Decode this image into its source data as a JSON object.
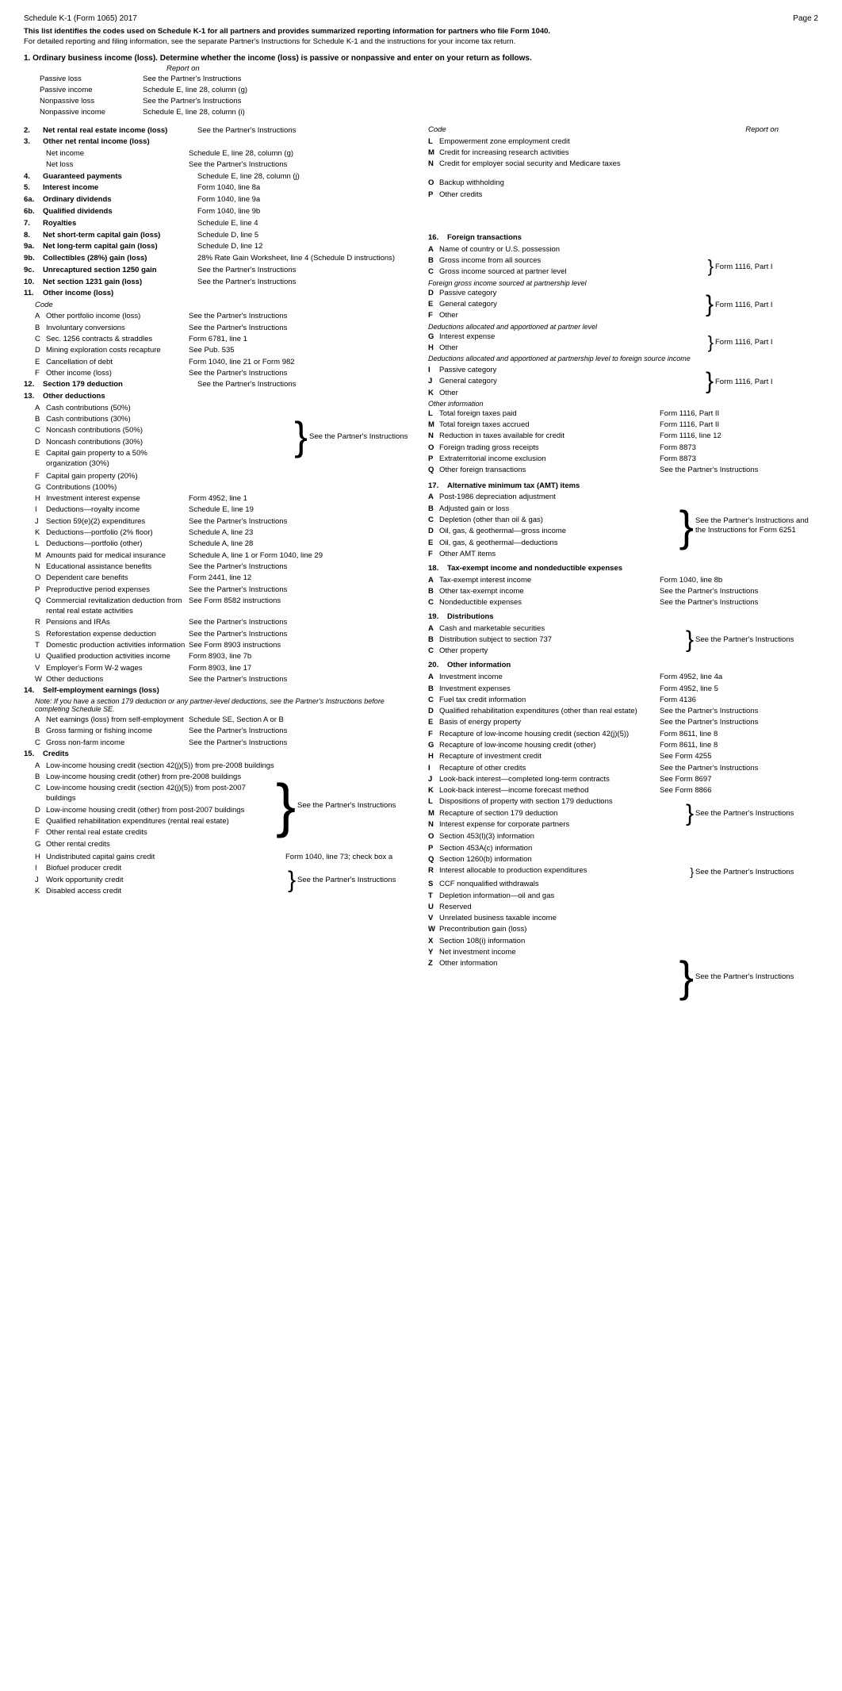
{
  "header": {
    "left": "Schedule K-1 (Form 1065) 2017",
    "right": "Page 2"
  },
  "intro": {
    "line1": "This list identifies the codes used on Schedule K-1 for all partners and provides summarized reporting information for partners who file Form 1040.",
    "line2": "For detailed reporting and filing information, see the separate Partner's Instructions for Schedule K-1 and the instructions for your income tax return."
  },
  "section1": {
    "title": "1. Ordinary business income (loss).",
    "desc": "Determine whether the income (loss) is passive or nonpassive and enter on your return as follows.",
    "report_on_label": "Report on",
    "items": [
      {
        "label": "Passive loss",
        "value": "See the Partner's Instructions"
      },
      {
        "label": "Passive income",
        "value": "Schedule E, line 28, column (g)"
      },
      {
        "label": "Nonpassive loss",
        "value": "See the Partner's Instructions"
      },
      {
        "label": "Nonpassive income",
        "value": "Schedule E, line 28, column (i)"
      }
    ]
  },
  "left_items": [
    {
      "num": "2.",
      "label": "Net rental real estate income (loss)",
      "bold": true,
      "instruction": "See the Partner's Instructions"
    },
    {
      "num": "3.",
      "label": "Other net rental income (loss)",
      "bold": true,
      "instruction": ""
    },
    {
      "sub": [
        {
          "label": "Net income",
          "instruction": "Schedule E, line 28, column (g)"
        },
        {
          "label": "Net loss",
          "instruction": "See the Partner's Instructions"
        }
      ]
    },
    {
      "num": "4.",
      "label": "Guaranteed payments",
      "bold": true,
      "instruction": "Schedule E, line 28, column (j)"
    },
    {
      "num": "5.",
      "label": "Interest income",
      "bold": true,
      "instruction": "Form 1040, line 8a"
    },
    {
      "num": "6a.",
      "label": "Ordinary dividends",
      "bold": true,
      "instruction": "Form 1040, line 9a"
    },
    {
      "num": "6b.",
      "label": "Qualified dividends",
      "bold": true,
      "instruction": "Form 1040, line 9b"
    },
    {
      "num": "7.",
      "label": "Royalties",
      "bold": true,
      "instruction": "Schedule E, line 4"
    },
    {
      "num": "8.",
      "label": "Net short-term capital gain (loss)",
      "bold": true,
      "instruction": "Schedule D, line 5"
    },
    {
      "num": "9a.",
      "label": "Net long-term capital gain (loss)",
      "bold": true,
      "instruction": "Schedule D, line 12"
    },
    {
      "num": "9b.",
      "label": "Collectibles (28%) gain (loss)",
      "bold": true,
      "instruction": "28% Rate Gain Worksheet, line 4 (Schedule D instructions)"
    },
    {
      "num": "9c.",
      "label": "Unrecaptured section 1250 gain",
      "bold": true,
      "instruction": "See the Partner's Instructions"
    },
    {
      "num": "10.",
      "label": "Net section 1231 gain (loss)",
      "bold": true,
      "instruction": "See the Partner's Instructions"
    },
    {
      "num": "11.",
      "label": "Other income (loss)",
      "bold": true,
      "instruction": ""
    },
    {
      "code_label": "Code",
      "sub_codes": [
        {
          "code": "A",
          "label": "Other portfolio income (loss)",
          "instruction": "See the Partner's Instructions"
        },
        {
          "code": "B",
          "label": "Involuntary conversions",
          "instruction": "See the Partner's Instructions"
        },
        {
          "code": "C",
          "label": "Sec. 1256 contracts & straddles",
          "instruction": "Form 6781, line 1"
        },
        {
          "code": "D",
          "label": "Mining exploration costs recapture",
          "instruction": "See Pub. 535"
        },
        {
          "code": "E",
          "label": "Cancellation of debt",
          "instruction": "Form 1040, line 21 or Form 982"
        },
        {
          "code": "F",
          "label": "Other income (loss)",
          "instruction": "See the Partner's Instructions"
        }
      ]
    },
    {
      "num": "12.",
      "label": "Section 179 deduction",
      "bold": true,
      "instruction": "See the Partner's Instructions"
    },
    {
      "num": "13.",
      "label": "Other deductions",
      "bold": true,
      "instruction": ""
    },
    {
      "sub_codes_deductions": [
        {
          "code": "A",
          "label": "Cash contributions (50%)"
        },
        {
          "code": "B",
          "label": "Cash contributions (30%)"
        },
        {
          "code": "C",
          "label": "Noncash contributions (50%)"
        },
        {
          "code": "D",
          "label": "Noncash contributions (30%)"
        },
        {
          "code": "E",
          "label": "Capital gain property to a 50% organization (30%)"
        }
      ],
      "brace_instruction": "See the Partner's Instructions"
    },
    {
      "sub_codes_deductions2": [
        {
          "code": "F",
          "label": "Capital gain property (20%)"
        },
        {
          "code": "G",
          "label": "Contributions (100%)"
        }
      ]
    },
    {
      "sub_codes_deductions3": [
        {
          "code": "H",
          "label": "Investment interest expense",
          "instruction": "Form 4952, line 1"
        },
        {
          "code": "I",
          "label": "Deductions—royalty income",
          "instruction": "Schedule E, line 19"
        },
        {
          "code": "J",
          "label": "Section 59(e)(2) expenditures",
          "instruction": "See the Partner's Instructions"
        },
        {
          "code": "K",
          "label": "Deductions—portfolio (2% floor)",
          "instruction": "Schedule A, line 23"
        },
        {
          "code": "L",
          "label": "Deductions—portfolio (other)",
          "instruction": "Schedule A, line 28"
        },
        {
          "code": "M",
          "label": "Amounts paid for medical insurance",
          "instruction": "Schedule A, line 1 or Form 1040, line 29"
        },
        {
          "code": "N",
          "label": "Educational assistance benefits",
          "instruction": "See the Partner's Instructions"
        },
        {
          "code": "O",
          "label": "Dependent care benefits",
          "instruction": "Form 2441, line 12"
        },
        {
          "code": "P",
          "label": "Preproductive period expenses",
          "instruction": "See the Partner's Instructions"
        },
        {
          "code": "Q",
          "label": "Commercial revitalization deduction from rental real estate activities",
          "instruction": "See Form 8582 instructions"
        },
        {
          "code": "R",
          "label": "Pensions and IRAs",
          "instruction": "See the Partner's Instructions"
        },
        {
          "code": "S",
          "label": "Reforestation expense deduction",
          "instruction": "See the Partner's Instructions"
        },
        {
          "code": "T",
          "label": "Domestic production activities information",
          "instruction": "See Form 8903 instructions"
        },
        {
          "code": "U",
          "label": "Qualified production activities income",
          "instruction": "Form 8903, line 7b"
        },
        {
          "code": "V",
          "label": "Employer's Form W-2 wages",
          "instruction": "Form 8903, line 17"
        },
        {
          "code": "W",
          "label": "Other deductions",
          "instruction": "See the Partner's Instructions"
        }
      ]
    },
    {
      "num": "14.",
      "label": "Self-employment earnings (loss)",
      "bold": true,
      "instruction": ""
    },
    {
      "note": "Note: If you have a section 179 deduction or any partner-level deductions, see the Partner's Instructions before completing Schedule SE."
    },
    {
      "sub_codes_se": [
        {
          "code": "A",
          "label": "Net earnings (loss) from self-employment",
          "instruction": "Schedule SE, Section A or B"
        },
        {
          "code": "B",
          "label": "Gross farming or fishing income",
          "instruction": "See the Partner's Instructions"
        },
        {
          "code": "C",
          "label": "Gross non-farm income",
          "instruction": "See the Partner's Instructions"
        }
      ]
    },
    {
      "num": "15.",
      "label": "Credits",
      "bold": true,
      "instruction": ""
    }
  ],
  "credits_items": [
    {
      "code": "A",
      "label": "Low-income housing credit (section 42(j)(5)) from pre-2008 buildings"
    },
    {
      "code": "B",
      "label": "Low-income housing credit (other) from pre-2008 buildings"
    },
    {
      "code": "C",
      "label": "Low-income housing credit (section 42(j)(5)) from post-2007 buildings"
    },
    {
      "code": "D",
      "label": "Low-income housing credit (other) from post-2007 buildings"
    },
    {
      "code": "E",
      "label": "Qualified rehabilitation expenditures (rental real estate)"
    },
    {
      "code": "F",
      "label": "Other rental real estate credits"
    },
    {
      "code": "G",
      "label": "Other rental credits"
    },
    {
      "code": "H",
      "label": "Undistributed capital gains credit",
      "instruction": "Form 1040, line 73; check box a"
    },
    {
      "code": "I",
      "label": "Biofuel producer credit"
    },
    {
      "code": "J",
      "label": "Work opportunity credit"
    },
    {
      "code": "K",
      "label": "Disabled access credit"
    }
  ],
  "credits_brace_instruction": "See the Partner's Instructions",
  "right_items": {
    "code_header": "Code",
    "report_on_header": "Report on",
    "items": [
      {
        "code": "L",
        "label": "Empowerment zone employment credit"
      },
      {
        "code": "M",
        "label": "Credit for increasing research activities"
      },
      {
        "code": "N",
        "label": "Credit for employer social security and Medicare taxes"
      }
    ],
    "op_items": [
      {
        "code": "O",
        "label": "Backup withholding"
      },
      {
        "code": "P",
        "label": "Other credits"
      }
    ],
    "section16": {
      "num": "16.",
      "title": "Foreign transactions",
      "items": [
        {
          "code": "A",
          "label": "Name of country or U.S. possession"
        },
        {
          "code": "B",
          "label": "Gross income from all sources"
        },
        {
          "code": "C",
          "label": "Gross income sourced at partner level"
        }
      ],
      "brace_instruction_bc": "Form 1116, Part I",
      "foreign_gross_label": "Foreign gross income sourced at partnership level",
      "items2": [
        {
          "code": "D",
          "label": "Passive category"
        },
        {
          "code": "E",
          "label": "General category"
        },
        {
          "code": "F",
          "label": "Other"
        }
      ],
      "brace_instruction_def": "Form 1116, Part I",
      "deductions_label1": "Deductions allocated and apportioned at partner level",
      "items3": [
        {
          "code": "G",
          "label": "Interest expense"
        },
        {
          "code": "H",
          "label": "Other"
        }
      ],
      "brace_instruction_gh": "Form 1116, Part I",
      "deductions_label2": "Deductions allocated and apportioned at partnership level to foreign source income",
      "items4": [
        {
          "code": "I",
          "label": "Passive category"
        },
        {
          "code": "J",
          "label": "General category"
        },
        {
          "code": "K",
          "label": "Other"
        }
      ],
      "brace_instruction_ijk": "Form 1116, Part I",
      "other_info_label": "Other information",
      "items5": [
        {
          "code": "L",
          "label": "Total foreign taxes paid",
          "instruction": "Form 1116, Part II"
        },
        {
          "code": "M",
          "label": "Total foreign taxes accrued",
          "instruction": "Form 1116, Part II"
        },
        {
          "code": "N",
          "label": "Reduction in taxes available for credit",
          "instruction": "Form 1116, line 12"
        },
        {
          "code": "O",
          "label": "Foreign trading gross receipts",
          "instruction": "Form 8873"
        },
        {
          "code": "P",
          "label": "Extraterritorial income exclusion",
          "instruction": "Form 8873"
        },
        {
          "code": "Q",
          "label": "Other foreign transactions",
          "instruction": "See the Partner's Instructions"
        }
      ]
    },
    "section17": {
      "num": "17.",
      "title": "Alternative minimum tax (AMT) items",
      "items": [
        {
          "code": "A",
          "label": "Post-1986 depreciation adjustment"
        },
        {
          "code": "B",
          "label": "Adjusted gain or loss"
        },
        {
          "code": "C",
          "label": "Depletion (other than oil & gas)"
        },
        {
          "code": "D",
          "label": "Oil, gas, & geothermal—gross income"
        },
        {
          "code": "E",
          "label": "Oil, gas, & geothermal—deductions"
        },
        {
          "code": "F",
          "label": "Other AMT items"
        }
      ],
      "brace_instruction": "See the Partner's Instructions and the Instructions for Form 6251"
    },
    "section18": {
      "num": "18.",
      "title": "Tax-exempt income and nondeductible expenses",
      "items": [
        {
          "code": "A",
          "label": "Tax-exempt interest income",
          "instruction": "Form 1040, line 8b"
        },
        {
          "code": "B",
          "label": "Other tax-exempt income",
          "instruction": "See the Partner's Instructions"
        },
        {
          "code": "C",
          "label": "Nondeductible expenses",
          "instruction": "See the Partner's Instructions"
        }
      ]
    },
    "section19": {
      "num": "19.",
      "title": "Distributions",
      "items": [
        {
          "code": "A",
          "label": "Cash and marketable securities"
        },
        {
          "code": "B",
          "label": "Distribution subject to section 737"
        },
        {
          "code": "C",
          "label": "Other property"
        }
      ],
      "brace_instruction": "See the Partner's Instructions"
    },
    "section20": {
      "num": "20.",
      "title": "Other information",
      "items": [
        {
          "code": "A",
          "label": "Investment income",
          "instruction": "Form 4952, line 4a"
        },
        {
          "code": "B",
          "label": "Investment expenses",
          "instruction": "Form 4952, line 5"
        },
        {
          "code": "C",
          "label": "Fuel tax credit information",
          "instruction": "Form 4136"
        },
        {
          "code": "D",
          "label": "Qualified rehabilitation expenditures (other than real estate)",
          "instruction": "See the Partner's Instructions"
        },
        {
          "code": "E",
          "label": "Basis of energy property",
          "instruction": "See the Partner's Instructions"
        },
        {
          "code": "F",
          "label": "Recapture of low-income housing credit (section 42(j)(5))",
          "instruction": "Form 8611, line 8"
        },
        {
          "code": "G",
          "label": "Recapture of low-income housing credit (other)",
          "instruction": "Form 8611, line 8"
        },
        {
          "code": "H",
          "label": "Recapture of investment credit",
          "instruction": "See Form 4255"
        },
        {
          "code": "I",
          "label": "Recapture of other credits",
          "instruction": "See the Partner's Instructions"
        },
        {
          "code": "J",
          "label": "Look-back interest—completed long-term contracts",
          "instruction": "See Form 8697"
        },
        {
          "code": "K",
          "label": "Look-back interest—income forecast method",
          "instruction": "See Form 8866"
        },
        {
          "code": "L",
          "label": "Dispositions of property with section 179 deductions"
        },
        {
          "code": "M",
          "label": "Recapture of section 179 deduction"
        },
        {
          "code": "N",
          "label": "Interest expense for corporate partners"
        },
        {
          "code": "O",
          "label": "Section 453(l)(3) information"
        },
        {
          "code": "P",
          "label": "Section 453A(c) information"
        },
        {
          "code": "Q",
          "label": "Section 1260(b) information"
        },
        {
          "code": "R",
          "label": "Interest allocable to production expenditures"
        },
        {
          "code": "S",
          "label": "CCF nonqualified withdrawals"
        },
        {
          "code": "T",
          "label": "Depletion information—oil and gas"
        },
        {
          "code": "U",
          "label": "Reserved"
        },
        {
          "code": "V",
          "label": "Unrelated business taxable income"
        },
        {
          "code": "W",
          "label": "Precontribution gain (loss)"
        },
        {
          "code": "X",
          "label": "Section 108(i) information"
        },
        {
          "code": "Y",
          "label": "Net investment income"
        },
        {
          "code": "Z",
          "label": "Other information"
        }
      ],
      "brace_lmn_instruction": "See the Partner's Instructions",
      "brace_rst_instruction": "See the Partner's Instructions"
    }
  }
}
